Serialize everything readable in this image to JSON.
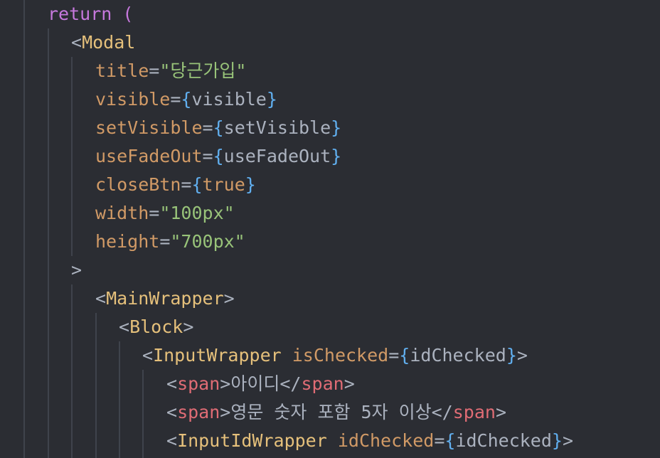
{
  "code": {
    "l1": {
      "kw": "return",
      "paren": " ("
    },
    "l2": {
      "open": "<",
      "name": "Modal"
    },
    "l3": {
      "attr": "title",
      "eq": "=",
      "str": "\"당근가입\""
    },
    "l4": {
      "attr": "visible",
      "eq": "=",
      "lb": "{",
      "val": "visible",
      "rb": "}"
    },
    "l5": {
      "attr": "setVisible",
      "eq": "=",
      "lb": "{",
      "val": "setVisible",
      "rb": "}"
    },
    "l6": {
      "attr": "useFadeOut",
      "eq": "=",
      "lb": "{",
      "val": "useFadeOut",
      "rb": "}"
    },
    "l7": {
      "attr": "closeBtn",
      "eq": "=",
      "lb": "{",
      "val": "true",
      "rb": "}"
    },
    "l8": {
      "attr": "width",
      "eq": "=",
      "str": "\"100px\""
    },
    "l9": {
      "attr": "height",
      "eq": "=",
      "str": "\"700px\""
    },
    "l10": {
      "close": ">"
    },
    "l11": {
      "open": "<",
      "name": "MainWrapper",
      "close": ">"
    },
    "l12": {
      "open": "<",
      "name": "Block",
      "close": ">"
    },
    "l13": {
      "open": "<",
      "name": "InputWrapper",
      "sp": " ",
      "attr": "isChecked",
      "eq": "=",
      "lb": "{",
      "val": "idChecked",
      "rb": "}",
      "close": ">"
    },
    "l14": {
      "open": "<",
      "tag": "span",
      "gt": ">",
      "text": "아이디",
      "endopen": "</",
      "endtag": "span",
      "endgt": ">"
    },
    "l15": {
      "open": "<",
      "tag": "span",
      "gt": ">",
      "text": "영문 숫자 포함 5자 이상",
      "endopen": "</",
      "endtag": "span",
      "endgt": ">"
    },
    "l16": {
      "open": "<",
      "name": "InputIdWrapper",
      "sp": " ",
      "attr": "idChecked",
      "eq": "=",
      "lb": "{",
      "val": "idChecked",
      "rb": "}",
      "close": ">"
    }
  }
}
